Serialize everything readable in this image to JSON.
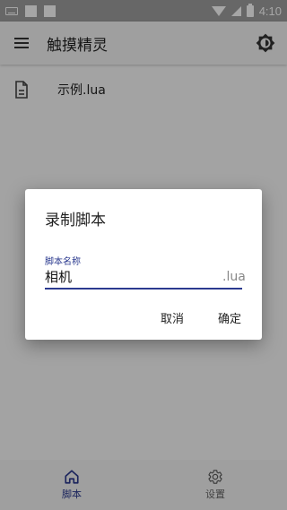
{
  "status_bar": {
    "time": "4:10"
  },
  "app_bar": {
    "title": "触摸精灵"
  },
  "files": [
    {
      "name": "示例.lua"
    }
  ],
  "dialog": {
    "title": "录制脚本",
    "field_label": "脚本名称",
    "field_value": "相机",
    "suffix": ".lua",
    "cancel_label": "取消",
    "confirm_label": "确定"
  },
  "bottom_nav": [
    {
      "label": "脚本",
      "active": true
    },
    {
      "label": "设置",
      "active": false
    }
  ],
  "colors": {
    "accent": "#2b3a8f",
    "scrim": "#000000"
  }
}
